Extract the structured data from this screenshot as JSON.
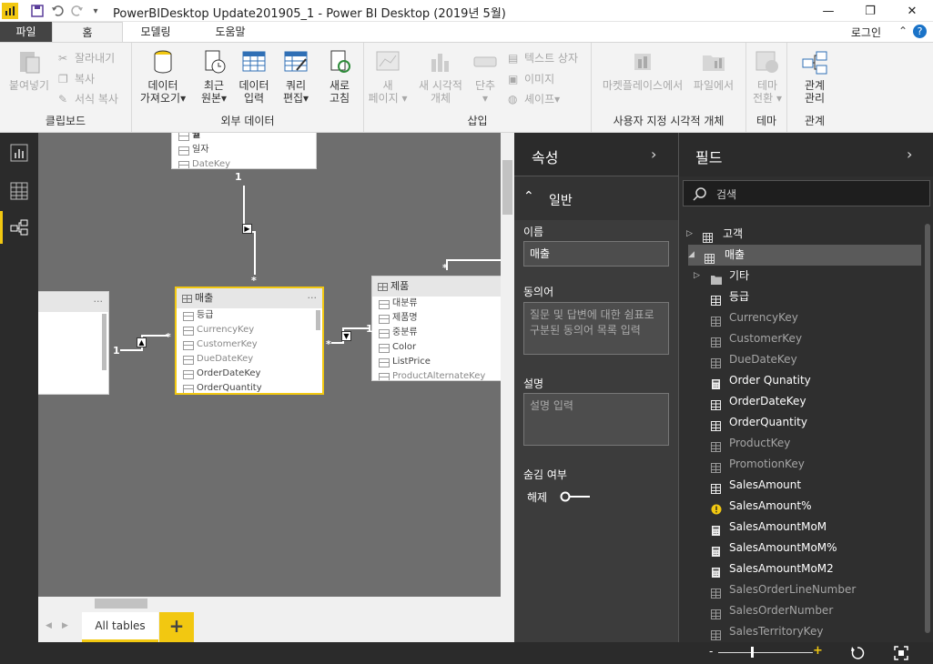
{
  "titlebar": {
    "title": "PowerBIDesktop Update201905_1 - Power BI Desktop (2019년 5월)"
  },
  "tabs": [
    {
      "label": "파일"
    },
    {
      "label": "홈"
    },
    {
      "label": "모델링"
    },
    {
      "label": "도움말"
    }
  ],
  "account": {
    "login": "로그인",
    "help": "?"
  },
  "ribbon": {
    "clipboard": {
      "paste": "붙여넣기",
      "cut": "잘라내기",
      "copy": "복사",
      "format_copy": "서식 복사",
      "label": "클립보드"
    },
    "external": {
      "get_data_1": "데이터",
      "get_data_2": "가져오기",
      "recent_1": "최근",
      "recent_2": "원본",
      "enter_1": "데이터",
      "enter_2": "입력",
      "query_1": "쿼리",
      "query_2": "편집",
      "refresh_1": "새로",
      "refresh_2": "고침",
      "label": "외부 데이터"
    },
    "insert": {
      "new_page_1": "새",
      "new_page_2": "페이지",
      "new_visual_1": "새 시각적",
      "new_visual_2": "개체",
      "single_1": "단추",
      "textbox": "텍스트 상자",
      "image": "이미지",
      "shape": "셰이프",
      "label": "삽입"
    },
    "custom": {
      "marketplace": "마켓플레이스에서",
      "from_file": "파일에서",
      "label": "사용자 지정 시각적 개체"
    },
    "theme": {
      "switch_1": "테마",
      "switch_2": "전환",
      "label": "테마"
    },
    "relations": {
      "manage_1": "관계",
      "manage_2": "관리",
      "label": "관계"
    }
  },
  "canvas": {
    "top_table": {
      "rows": [
        "월",
        "일자",
        "DateKey"
      ]
    },
    "sales_table": {
      "name": "매출",
      "rows": [
        "등급",
        "CurrencyKey",
        "CustomerKey",
        "DueDateKey",
        "OrderDateKey",
        "OrderQuantity"
      ]
    },
    "product_table": {
      "name": "제품",
      "rows": [
        "대분류",
        "제품명",
        "중분류",
        "Color",
        "ListPrice",
        "ProductAlternateKey"
      ]
    },
    "card_menu": "···",
    "rel_one": "1",
    "rel_many": "*"
  },
  "sheet_tabs": {
    "all_tables": "All tables",
    "add": "+"
  },
  "properties": {
    "title": "속성",
    "section": "일반",
    "name_label": "이름",
    "name_value": "매출",
    "synonym_label": "동의어",
    "synonym_placeholder": "질문 및 답변에 대한 쉼표로 구분된 동의어 목록 입력",
    "desc_label": "설명",
    "desc_placeholder": "설명 입력",
    "hidden_label": "숨김 여부",
    "hidden_value": "해제"
  },
  "fields": {
    "title": "필드",
    "search_placeholder": "검색",
    "items": [
      {
        "label": "고객",
        "kind": "table",
        "expanded": false,
        "bold": true
      },
      {
        "label": "매출",
        "kind": "table",
        "expanded": true,
        "bold": true
      },
      {
        "label": "기타",
        "kind": "folder",
        "bold": true
      },
      {
        "label": "등급",
        "kind": "column",
        "bold": true
      },
      {
        "label": "CurrencyKey",
        "kind": "column",
        "bold": false
      },
      {
        "label": "CustomerKey",
        "kind": "column",
        "bold": false
      },
      {
        "label": "DueDateKey",
        "kind": "column",
        "bold": false
      },
      {
        "label": "Order Qunatity",
        "kind": "measure",
        "bold": true
      },
      {
        "label": "OrderDateKey",
        "kind": "column",
        "bold": true
      },
      {
        "label": "OrderQuantity",
        "kind": "column",
        "bold": true
      },
      {
        "label": "ProductKey",
        "kind": "column",
        "bold": false
      },
      {
        "label": "PromotionKey",
        "kind": "column",
        "bold": false
      },
      {
        "label": "SalesAmount",
        "kind": "column",
        "bold": true
      },
      {
        "label": "SalesAmount%",
        "kind": "warning",
        "bold": true
      },
      {
        "label": "SalesAmountMoM",
        "kind": "measure",
        "bold": true
      },
      {
        "label": "SalesAmountMoM%",
        "kind": "measure",
        "bold": true
      },
      {
        "label": "SalesAmountMoM2",
        "kind": "measure",
        "bold": true
      },
      {
        "label": "SalesOrderLineNumber",
        "kind": "column",
        "bold": false
      },
      {
        "label": "SalesOrderNumber",
        "kind": "column",
        "bold": false
      },
      {
        "label": "SalesTerritoryKey",
        "kind": "column",
        "bold": false
      }
    ]
  },
  "status": {
    "zoom_minus": "-",
    "zoom_plus": "+"
  },
  "colors": {
    "accent": "#f2c811",
    "dark": "#2b2b2b",
    "panel": "#3c3c3c",
    "canvas": "#6e6e6e"
  }
}
